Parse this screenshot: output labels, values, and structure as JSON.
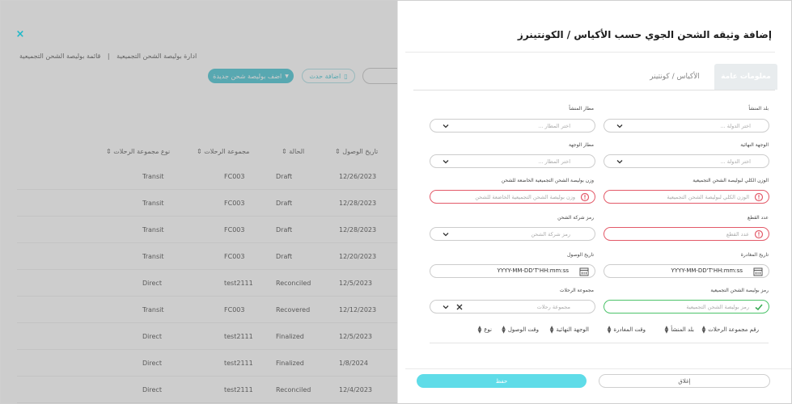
{
  "background": {
    "breadcrumb": {
      "root": "ادارة بوليصة الشحن التجميعية",
      "separator": "|",
      "current": "قائمة بوليصة الشحن التجميعية"
    },
    "add_button": "اضف بوليصة شحن جديدة",
    "update_button": "اضافة حدث",
    "table": {
      "headers": {
        "arrival": "تاريخ الوصول",
        "status": "الحالة",
        "group": "مجموعة الرحلات",
        "type": "نوع مجموعة الرحلات"
      },
      "rows": [
        {
          "type": "Transit",
          "group": "FC003",
          "status": "Draft",
          "date": "12/26/2023"
        },
        {
          "type": "Transit",
          "group": "FC003",
          "status": "Draft",
          "date": "12/28/2023"
        },
        {
          "type": "Transit",
          "group": "FC003",
          "status": "Draft",
          "date": "12/28/2023"
        },
        {
          "type": "Transit",
          "group": "FC003",
          "status": "Draft",
          "date": "12/20/2023"
        },
        {
          "type": "Direct",
          "group": "test2111",
          "status": "Reconciled",
          "date": "12/5/2023"
        },
        {
          "type": "Transit",
          "group": "FC003",
          "status": "Recovered",
          "date": "12/12/2023"
        },
        {
          "type": "Direct",
          "group": "test2111",
          "status": "Finalized",
          "date": "12/5/2023"
        },
        {
          "type": "Direct",
          "group": "test2111",
          "status": "Finalized",
          "date": "1/8/2024"
        },
        {
          "type": "Direct",
          "group": "test2111",
          "status": "Reconciled",
          "date": "12/4/2023"
        }
      ]
    }
  },
  "panel": {
    "title": "إضافة وثيقه الشحن الجوي حسب الأكياس / الكونتينرز",
    "close_icon": "×",
    "tabs": {
      "general": "معلومات عامة",
      "bags": "الأكياس / كونتينر"
    },
    "fields": {
      "origin_country": {
        "label": "بلد المنشأ",
        "placeholder": "اختر الدولة ..."
      },
      "origin_airport": {
        "label": "مطار المنشأ",
        "placeholder": "اختر المطار ..."
      },
      "final_destination": {
        "label": "الوجهة النهائية",
        "placeholder": "اختر الدولة ..."
      },
      "destination_airport": {
        "label": "مطار الوجهة",
        "placeholder": "اختر المطار ..."
      },
      "total_weight": {
        "label": "الوزن الكلي لبوليصة الشحن التجميعية",
        "placeholder": "الوزن الكلي لبوليصة الشحن التجميعية"
      },
      "chargeable_weight": {
        "label": "وزن بوليصة الشحن التجميعية الخاضعة للشحن",
        "placeholder": "وزن بوليصة الشحن التجميعية الخاضعة للشحن"
      },
      "pieces": {
        "label": "عدد القطع",
        "placeholder": "عدد القطع"
      },
      "carrier_code": {
        "label": "رمز شركة الشحن",
        "placeholder": "رمز شركة الشحن"
      },
      "departure_date": {
        "label": "تاريخ المغادرة",
        "value": "YYYY-MM-DD'T'HH:mm:ss"
      },
      "arrival_date": {
        "label": "تاريخ الوصول",
        "value": "YYYY-MM-DD'T'HH:mm:ss"
      },
      "mawb_code": {
        "label": "رمز بوليصة الشحن التجميعية",
        "placeholder": "رمز بوليصة الشحن التجميعية"
      },
      "flight_group": {
        "label": "مجموعة الرحلات",
        "placeholder": "مجموعة رحلات"
      }
    },
    "columns": [
      "رقم مجموعة الرحلات",
      "بلد المنشأ",
      "وقت المغادرة",
      "الوجهة النهائية",
      "وقت الوصول",
      "نوع"
    ],
    "buttons": {
      "cancel": "إغلاق",
      "save": "حفظ"
    },
    "colors": {
      "accent": "#1fb9c9",
      "error": "#e35a69",
      "success": "#4cc36a"
    }
  }
}
